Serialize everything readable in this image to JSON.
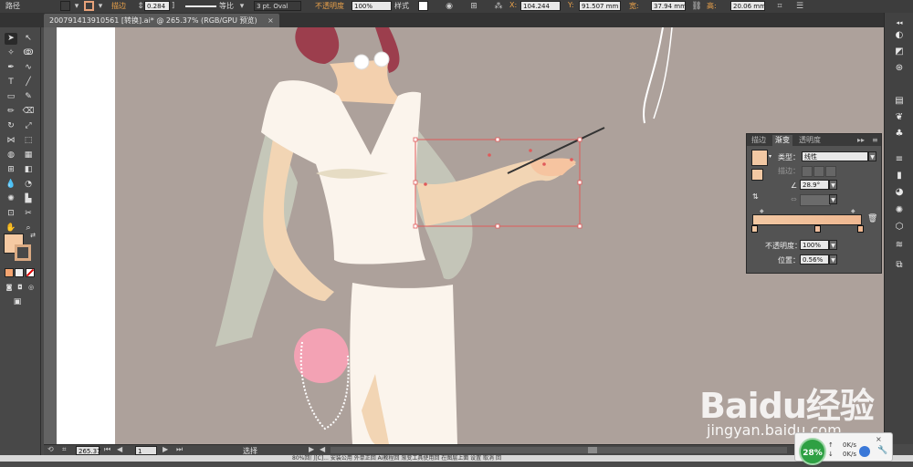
{
  "control_bar": {
    "object_type": "路径",
    "stroke_label": "描边",
    "stroke_value": "0.284",
    "stroke_unit": "]",
    "profile_label": "等比",
    "brush_value": "3 pt. Oval",
    "opacity_label": "不透明度",
    "opacity_value": "100%",
    "style_label": "样式",
    "x_label": "X:",
    "x_value": "104.244",
    "y_label": "Y:",
    "y_value": "91.507 mm",
    "w_label": "宽:",
    "w_value": "37.94 mm",
    "h_label": "高:",
    "h_value": "20.06 mm",
    "fill_color": "#f2c9a0",
    "stroke_color": "#e8a27a"
  },
  "document": {
    "tab_title": "200791413910561 [转换].ai* @ 265.37% (RGB/GPU 预览)",
    "close_label": "×"
  },
  "tools": {
    "fill_color": "#f5c9a2",
    "stroke_color": "#d9a982"
  },
  "gradient_panel": {
    "tabs": [
      "描边",
      "渐变",
      "透明度"
    ],
    "active_tab": "渐变",
    "type_label": "类型：",
    "type_value": "线性",
    "stroke_label": "描边：",
    "angle_value": "28.9°",
    "opacity_label": "不透明度：",
    "opacity_value": "100%",
    "position_label": "位置：",
    "position_value": "0.56%",
    "gradient_start": "#f2c8a3",
    "gradient_end": "#f0b891"
  },
  "status_bar": {
    "zoom": "265.37",
    "page": "1",
    "mode": "选择"
  },
  "taskbar": {
    "text": "80%回门[C]... 安装公用    外单正回   Ai教程回   渐变工具使用回   在图层上面    设置 取消  回"
  },
  "watermark": {
    "brand": "Baidu经验",
    "url": "jingyan.baidu.com"
  },
  "net_widget": {
    "percent": "28%",
    "up": "0K/s",
    "down": "0K/s"
  }
}
